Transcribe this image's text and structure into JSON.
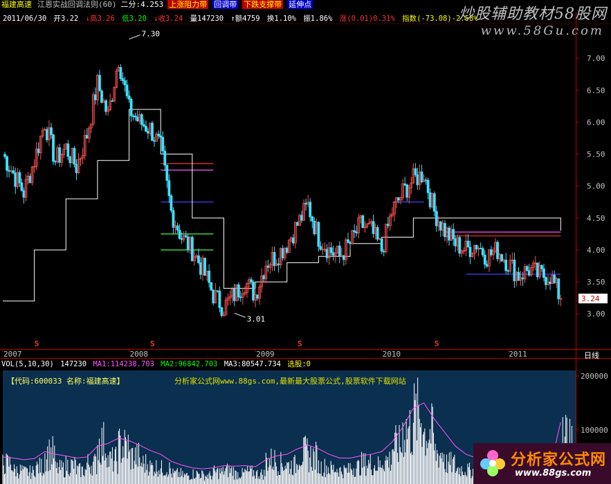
{
  "header": {
    "stock_name": "福建高速",
    "formula_name": "江恩实战回调法则",
    "period": "(60)",
    "erfen": "二分:4.253",
    "band_up": "上涨阻力带",
    "band_mid": "回调带",
    "band_down": "下跌支撑带",
    "band_ext": "延伸点"
  },
  "quote": {
    "date": "2011/06/30",
    "open": "开3.22",
    "high": "↓高3.26",
    "low": "低3.20",
    "close": "↓收3.24",
    "volume": "量147230",
    "amount": "↑额4759",
    "turnover": "换1.10%",
    "amplitude": "振1.86%",
    "change": "涨(0.01)0.31%",
    "index": "指数(-73.08)-2.58%"
  },
  "watermark": {
    "line1": "炒股辅助教材58股网",
    "line2": "www.58Gu.com"
  },
  "volume_header": {
    "name": "VOL(5,10,30)",
    "value": "147230",
    "ma1": "MA1:114238.703",
    "ma2": "MA2:96842.703",
    "ma3": "MA3:80547.734",
    "xg": "选股:0"
  },
  "info_bar": {
    "code": "【代码:600033 名称:福建高速】",
    "site": "分析家公式网www.88gs.com,最新最大股票公式,股票软件下载网站"
  },
  "logo": {
    "name": "分析家公式网",
    "url": "www.88gs.com"
  },
  "colors": {
    "background": "#000000",
    "axis_red": "#c00000",
    "candle_up": "#ff5050",
    "candle_down": "#40e0ff",
    "step_line": "#ffffff",
    "band_red": "#ff3030",
    "band_magenta": "#ff55ff",
    "band_blue": "#4040ff",
    "band_green": "#40ff40",
    "volume_bg": "#0b2f4f",
    "volume_bar": "#ffffff"
  },
  "chart_data": [
    {
      "type": "candlestick",
      "title": "",
      "period_label": "日线",
      "x_years": [
        "2007",
        "2008",
        "2009",
        "2010",
        "2011"
      ],
      "y_ticks": [
        3.0,
        3.5,
        4.0,
        4.5,
        5.0,
        5.5,
        6.0,
        6.5,
        7.0
      ],
      "ylim": [
        2.45,
        7.5
      ],
      "last_price": 3.24,
      "annotations": [
        {
          "label": "7.30",
          "value": 7.3,
          "date": "2008-01"
        },
        {
          "label": "3.01",
          "value": 3.01,
          "date": "2008-11"
        }
      ],
      "signal_markers": {
        "label": "S",
        "dates": [
          "2007-04",
          "2008-03",
          "2009-05",
          "2010-06"
        ]
      },
      "close_series": {
        "dates": [
          "2007-01",
          "2007-02",
          "2007-03",
          "2007-04",
          "2007-05",
          "2007-06",
          "2007-07",
          "2007-08",
          "2007-09",
          "2007-10",
          "2007-11",
          "2007-12",
          "2008-01",
          "2008-02",
          "2008-03",
          "2008-04",
          "2008-05",
          "2008-06",
          "2008-07",
          "2008-08",
          "2008-09",
          "2008-10",
          "2008-11",
          "2008-12",
          "2009-01",
          "2009-02",
          "2009-03",
          "2009-04",
          "2009-05",
          "2009-06",
          "2009-07",
          "2009-08",
          "2009-09",
          "2009-10",
          "2009-11",
          "2009-12",
          "2010-01",
          "2010-02",
          "2010-03",
          "2010-04",
          "2010-05",
          "2010-06",
          "2010-07",
          "2010-08",
          "2010-09",
          "2010-10",
          "2010-11",
          "2010-12",
          "2011-01",
          "2011-02",
          "2011-03",
          "2011-04",
          "2011-05",
          "2011-06"
        ],
        "values": [
          5.5,
          5.2,
          4.9,
          5.4,
          6.0,
          5.4,
          5.6,
          5.3,
          5.8,
          6.6,
          6.1,
          7.0,
          6.2,
          6.0,
          5.9,
          5.6,
          4.6,
          4.2,
          4.0,
          3.7,
          3.3,
          3.1,
          3.3,
          3.5,
          3.3,
          3.8,
          3.9,
          4.1,
          4.4,
          4.7,
          4.2,
          4.0,
          3.9,
          4.1,
          4.4,
          4.3,
          4.0,
          4.6,
          4.9,
          5.1,
          5.2,
          4.6,
          4.3,
          4.1,
          4.0,
          4.1,
          3.9,
          4.0,
          3.8,
          3.6,
          3.7,
          3.6,
          3.6,
          3.24
        ]
      },
      "step_line": {
        "dates": [
          "2007-01",
          "2007-04",
          "2007-07",
          "2007-10",
          "2008-01",
          "2008-04",
          "2008-07",
          "2008-10",
          "2009-01",
          "2009-04",
          "2009-07",
          "2009-10",
          "2010-01",
          "2010-04",
          "2010-07",
          "2010-10",
          "2011-01",
          "2011-04",
          "2011-06"
        ],
        "values": [
          3.2,
          4.0,
          4.8,
          5.4,
          6.2,
          5.5,
          4.5,
          3.4,
          3.5,
          3.8,
          3.9,
          4.1,
          4.2,
          4.5,
          4.5,
          4.5,
          4.5,
          4.5,
          4.3
        ]
      },
      "levels": [
        {
          "name": "red",
          "value": 5.35,
          "from": "2008-04",
          "to": "2008-09"
        },
        {
          "name": "magenta",
          "value": 5.25,
          "from": "2008-04",
          "to": "2008-09"
        },
        {
          "name": "blue",
          "value": 4.75,
          "from": "2008-04",
          "to": "2008-09"
        },
        {
          "name": "green",
          "value": 4.25,
          "from": "2008-04",
          "to": "2008-09"
        },
        {
          "name": "green",
          "value": 4.0,
          "from": "2008-04",
          "to": "2008-09"
        },
        {
          "name": "red",
          "value": 4.22,
          "from": "2010-07",
          "to": "2011-06"
        },
        {
          "name": "magenta",
          "value": 4.28,
          "from": "2010-07",
          "to": "2011-06"
        },
        {
          "name": "blue",
          "value": 3.62,
          "from": "2010-09",
          "to": "2011-06"
        },
        {
          "name": "blue",
          "value": 4.75,
          "from": "2010-02",
          "to": "2010-05"
        }
      ]
    },
    {
      "type": "bar",
      "title": "VOL",
      "y_ticks": [
        100000,
        200000
      ],
      "ylim": [
        0,
        210000
      ],
      "series": [
        {
          "name": "VOL",
          "values": [
            60000,
            40000,
            35000,
            50000,
            90000,
            45000,
            55000,
            40000,
            60000,
            120000,
            70000,
            110000,
            80000,
            60000,
            50000,
            45000,
            30000,
            25000,
            30000,
            25000,
            35000,
            40000,
            30000,
            35000,
            30000,
            70000,
            60000,
            55000,
            90000,
            80000,
            50000,
            45000,
            40000,
            50000,
            60000,
            55000,
            70000,
            110000,
            160000,
            200000,
            150000,
            90000,
            60000,
            45000,
            40000,
            50000,
            35000,
            40000,
            30000,
            28000,
            35000,
            30000,
            32000,
            147230
          ]
        },
        {
          "name": "MA1",
          "values": [
            50000,
            48000,
            45000,
            47000,
            60000,
            55000,
            52000,
            48000,
            50000,
            70000,
            75000,
            85000,
            80000,
            72000,
            62000,
            55000,
            42000,
            35000,
            30000,
            28000,
            30000,
            34000,
            33000,
            34000,
            32000,
            45000,
            52000,
            55000,
            65000,
            72000,
            65000,
            55000,
            48000,
            48000,
            52000,
            55000,
            60000,
            78000,
            105000,
            140000,
            150000,
            120000,
            95000,
            70000,
            55000,
            48000,
            42000,
            40000,
            36000,
            33000,
            33000,
            31000,
            32000,
            114238
          ]
        }
      ]
    }
  ]
}
